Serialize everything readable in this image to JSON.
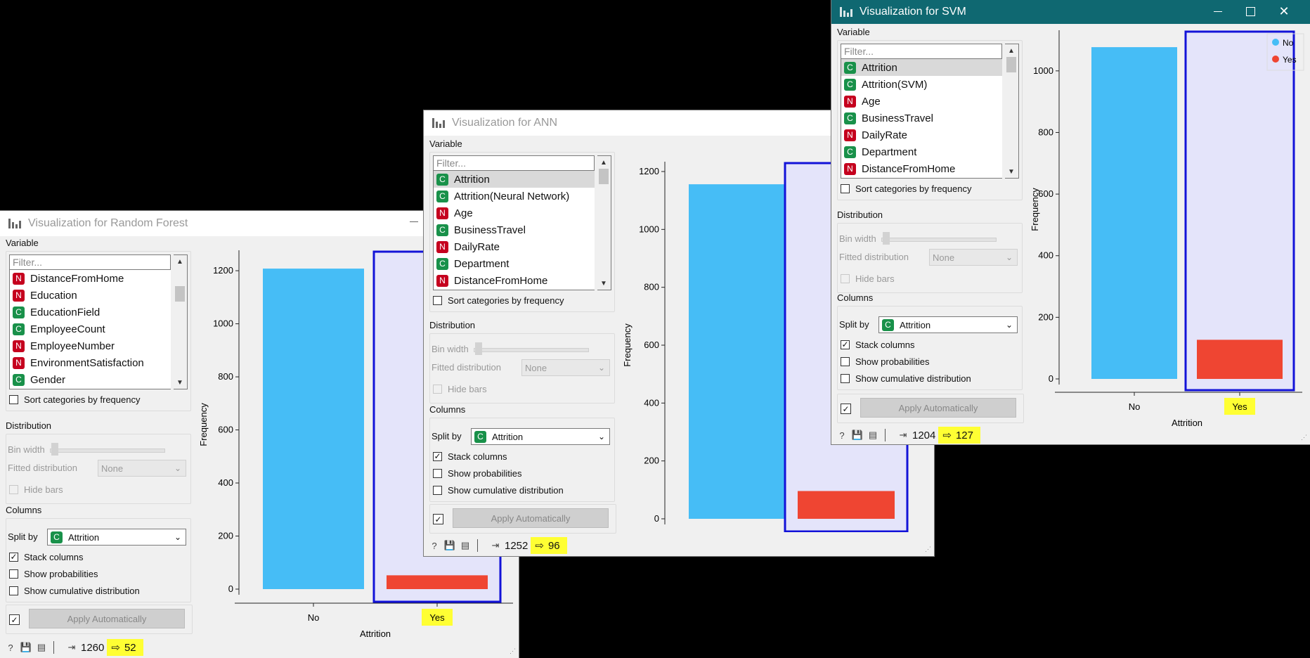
{
  "windows": {
    "rf": {
      "title": "Visualization for Random Forest",
      "variable_label": "Variable",
      "filter_placeholder": "Filter...",
      "items": [
        {
          "type": "N",
          "name": "DistanceFromHome"
        },
        {
          "type": "N",
          "name": "Education"
        },
        {
          "type": "C",
          "name": "EducationField"
        },
        {
          "type": "C",
          "name": "EmployeeCount"
        },
        {
          "type": "N",
          "name": "EmployeeNumber"
        },
        {
          "type": "N",
          "name": "EnvironmentSatisfaction"
        },
        {
          "type": "C",
          "name": "Gender"
        }
      ],
      "sort_label": "Sort categories by frequency",
      "distribution_label": "Distribution",
      "bin_width_label": "Bin width",
      "fitted_label": "Fitted distribution",
      "fitted_value": "None",
      "hide_bars_label": "Hide bars",
      "columns_label": "Columns",
      "split_label": "Split by",
      "split_value": "Attrition",
      "stack_label": "Stack columns",
      "prob_label": "Show probabilities",
      "cum_label": "Show cumulative distribution",
      "apply_label": "Apply Automatically",
      "in_count": "1260",
      "out_count": "52"
    },
    "ann": {
      "title": "Visualization for ANN",
      "variable_label": "Variable",
      "filter_placeholder": "Filter...",
      "items": [
        {
          "type": "C",
          "name": "Attrition"
        },
        {
          "type": "C",
          "name": "Attrition(Neural Network)"
        },
        {
          "type": "N",
          "name": "Age"
        },
        {
          "type": "C",
          "name": "BusinessTravel"
        },
        {
          "type": "N",
          "name": "DailyRate"
        },
        {
          "type": "C",
          "name": "Department"
        },
        {
          "type": "N",
          "name": "DistanceFromHome"
        }
      ],
      "sort_label": "Sort categories by frequency",
      "distribution_label": "Distribution",
      "bin_width_label": "Bin width",
      "fitted_label": "Fitted distribution",
      "fitted_value": "None",
      "hide_bars_label": "Hide bars",
      "columns_label": "Columns",
      "split_label": "Split by",
      "split_value": "Attrition",
      "stack_label": "Stack columns",
      "prob_label": "Show probabilities",
      "cum_label": "Show cumulative distribution",
      "apply_label": "Apply Automatically",
      "in_count": "1252",
      "out_count": "96"
    },
    "svm": {
      "title": "Visualization for SVM",
      "variable_label": "Variable",
      "filter_placeholder": "Filter...",
      "items": [
        {
          "type": "C",
          "name": "Attrition"
        },
        {
          "type": "C",
          "name": "Attrition(SVM)"
        },
        {
          "type": "N",
          "name": "Age"
        },
        {
          "type": "C",
          "name": "BusinessTravel"
        },
        {
          "type": "N",
          "name": "DailyRate"
        },
        {
          "type": "C",
          "name": "Department"
        },
        {
          "type": "N",
          "name": "DistanceFromHome"
        }
      ],
      "sort_label": "Sort categories by frequency",
      "distribution_label": "Distribution",
      "bin_width_label": "Bin width",
      "fitted_label": "Fitted distribution",
      "fitted_value": "None",
      "hide_bars_label": "Hide bars",
      "columns_label": "Columns",
      "split_label": "Split by",
      "split_value": "Attrition",
      "stack_label": "Stack columns",
      "prob_label": "Show probabilities",
      "cum_label": "Show cumulative distribution",
      "apply_label": "Apply Automatically",
      "in_count": "1204",
      "out_count": "127",
      "legend": [
        "No",
        "Yes"
      ]
    }
  },
  "colors": {
    "no": "#46bdf6",
    "yes": "#ef4532",
    "selection": "#1212d8",
    "selection_fill": "#e4e4fa",
    "highlight": "#ffff33",
    "active_titlebar": "#0f6871"
  },
  "chart_data": [
    {
      "type": "bar",
      "window": "Visualization for Random Forest",
      "categories": [
        "No",
        "Yes"
      ],
      "values": [
        1208,
        52
      ],
      "xlabel": "Attrition",
      "ylabel": "Frequency",
      "yticks": [
        0,
        200,
        400,
        600,
        800,
        1000,
        1200
      ],
      "ylim": [
        0,
        1240
      ],
      "selected": "Yes"
    },
    {
      "type": "bar",
      "window": "Visualization for ANN",
      "categories": [
        "No",
        "Yes"
      ],
      "values": [
        1156,
        96
      ],
      "xlabel": "Attrition",
      "ylabel": "Frequency",
      "yticks": [
        0,
        200,
        400,
        600,
        800,
        1000,
        1200
      ],
      "ylim": [
        0,
        1200
      ],
      "selected": "Yes"
    },
    {
      "type": "bar",
      "window": "Visualization for SVM",
      "categories": [
        "No",
        "Yes"
      ],
      "values": [
        1077,
        127
      ],
      "xlabel": "Attrition",
      "ylabel": "Frequency",
      "yticks": [
        0,
        200,
        400,
        600,
        800,
        1000
      ],
      "ylim": [
        0,
        1100
      ],
      "selected": "Yes",
      "legend": [
        "No",
        "Yes"
      ]
    }
  ]
}
